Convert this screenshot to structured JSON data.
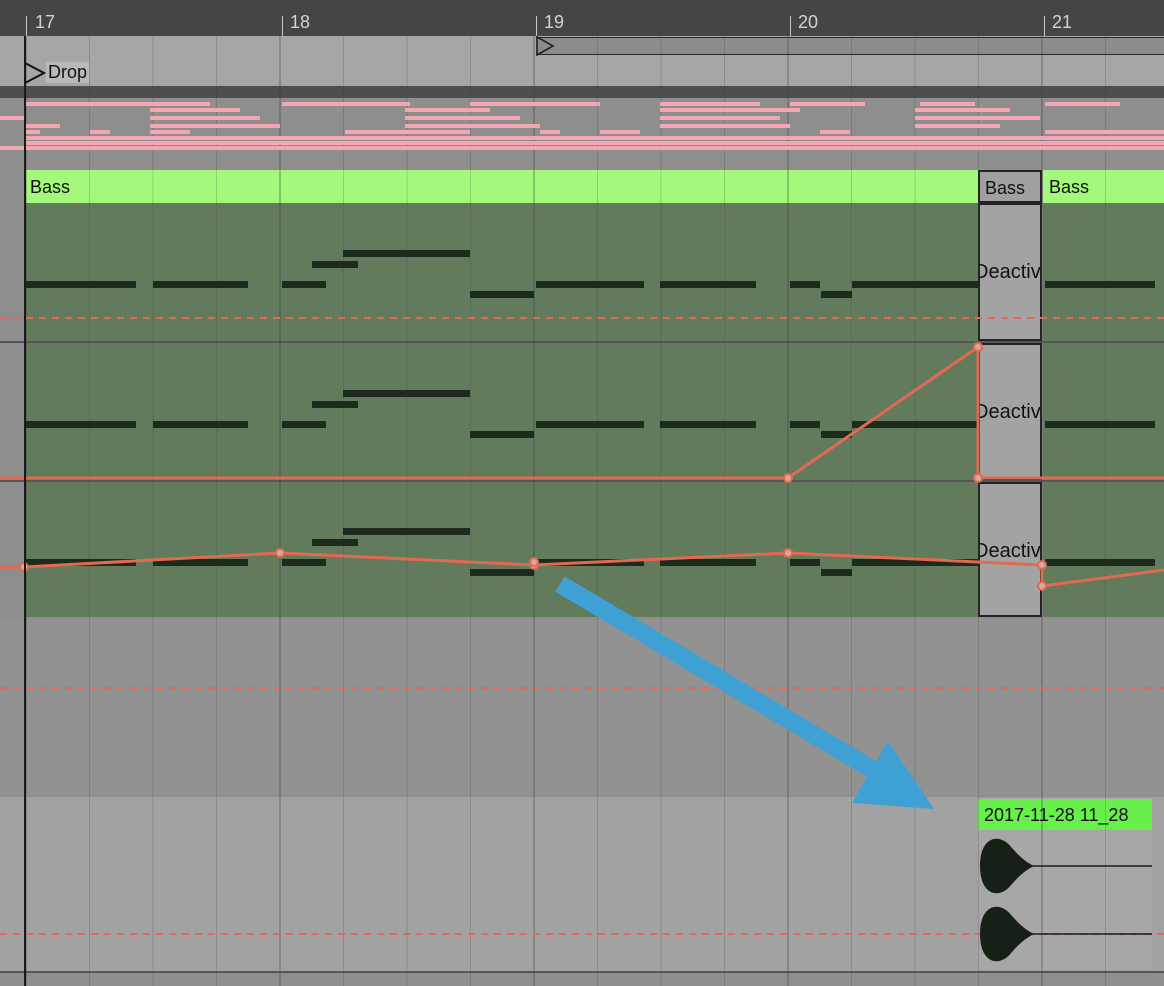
{
  "ruler": {
    "bars": [
      {
        "label": "17"
      },
      {
        "label": "18"
      },
      {
        "label": "19"
      },
      {
        "label": "20"
      },
      {
        "label": "21"
      }
    ]
  },
  "locator": {
    "name": "Drop"
  },
  "clips": {
    "bass": {
      "name": "Bass"
    },
    "deactivated": {
      "name": "Bass",
      "lane_text": "Deactiv"
    },
    "bass_2": {
      "name": "Bass"
    }
  },
  "audio_clip": {
    "name": "2017-11-28 11_28"
  },
  "colors": {
    "midi_clip": "#a4f97c",
    "audio_clip": "#67f04c",
    "automation": "#e06a52",
    "annotation_arrow": "#3fa0d4",
    "notes": "#1e2a1d",
    "overview_notes": "#f4a6b4"
  },
  "icons": {
    "locator": "triangle-play-icon",
    "loop": "loop-brace-icon",
    "arrow": "annotation-arrow-icon"
  }
}
